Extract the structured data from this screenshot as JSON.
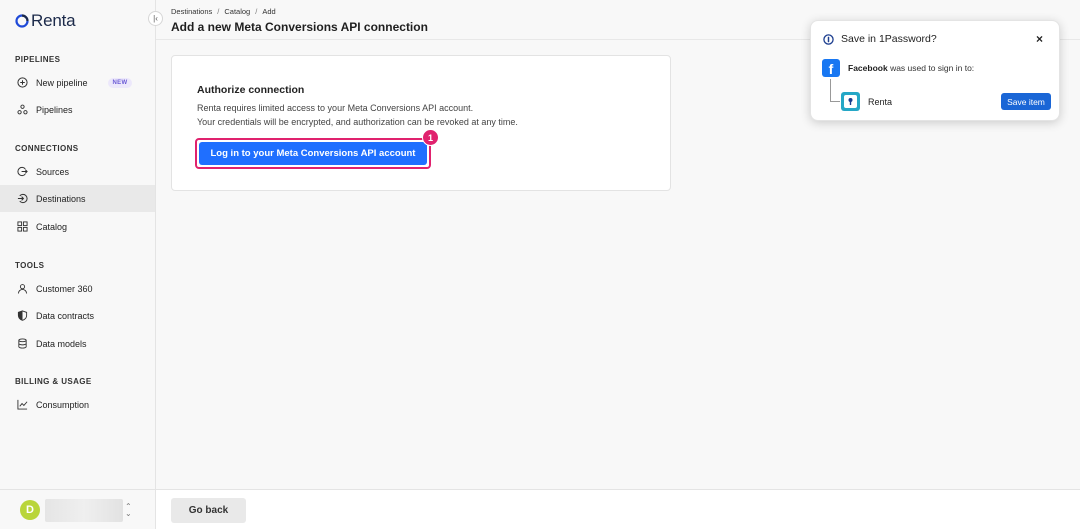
{
  "app": {
    "name": "Renta",
    "brand_color": "#1f6fff"
  },
  "sidebar": {
    "sections": [
      {
        "title": "PIPELINES",
        "items": [
          {
            "label": "New pipeline",
            "icon": "plus-circle-icon",
            "badge": "NEW"
          },
          {
            "label": "Pipelines",
            "icon": "pipelines-icon"
          }
        ]
      },
      {
        "title": "CONNECTIONS",
        "items": [
          {
            "label": "Sources",
            "icon": "sources-icon"
          },
          {
            "label": "Destinations",
            "icon": "destinations-icon",
            "active": true
          },
          {
            "label": "Catalog",
            "icon": "grid-icon"
          }
        ]
      },
      {
        "title": "TOOLS",
        "items": [
          {
            "label": "Customer 360",
            "icon": "user-icon"
          },
          {
            "label": "Data contracts",
            "icon": "shield-icon"
          },
          {
            "label": "Data models",
            "icon": "database-icon"
          }
        ]
      },
      {
        "title": "BILLING & USAGE",
        "items": [
          {
            "label": "Consumption",
            "icon": "chart-line-icon"
          }
        ]
      }
    ],
    "account": {
      "avatar_letter": "D",
      "avatar_color": "#b9d53a"
    }
  },
  "header": {
    "breadcrumb": [
      "Destinations",
      "Catalog",
      "Add"
    ],
    "title": "Add a new Meta Conversions API connection"
  },
  "card": {
    "title": "Authorize connection",
    "description_line1": "Renta requires limited access to your Meta Conversions API account.",
    "description_line2": "Your credentials will be encrypted, and authorization can be revoked at any time.",
    "login_button": "Log in to your Meta Conversions API account",
    "step_number": "1",
    "highlight_color": "#e0226e"
  },
  "footer": {
    "back_button": "Go back"
  },
  "onepassword": {
    "title": "Save in 1Password?",
    "close": "×",
    "provider": "Facebook",
    "used_text": "was used to sign in to:",
    "item_name": "Renta",
    "save_button": "Save item"
  }
}
